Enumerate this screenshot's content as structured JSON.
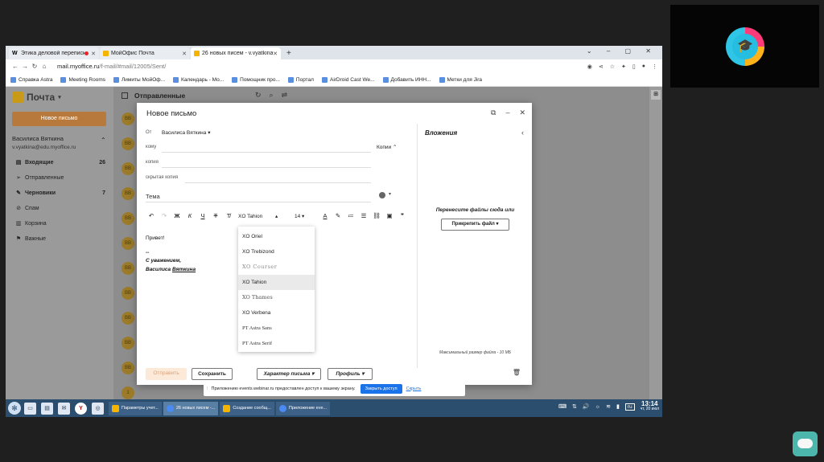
{
  "browser": {
    "tabs": [
      {
        "label": "Этика деловой переписки",
        "favicon": "W",
        "recording": true,
        "active": false
      },
      {
        "label": "МойОфис Почта",
        "favicon": "",
        "recording": false,
        "active": false
      },
      {
        "label": "26 новых писем - v.vyatkina",
        "favicon": "",
        "recording": false,
        "active": true
      }
    ],
    "url_host": "mail.myoffice.ru",
    "url_path": "/f-mail/#mail/12005/Sent/",
    "bookmarks": [
      "Справка Astra",
      "Meeting Rooms",
      "Лимиты МойОф...",
      "Календарь - Мо...",
      "Помощник про...",
      "Портал",
      "AirDroid Cast We...",
      "Добавить ИНН...",
      "Метки для Jira"
    ]
  },
  "mail": {
    "app_title": "Почта",
    "new_mail": "Новое письмо",
    "account_name": "Василиса Вяткина",
    "account_email": "v.vyatkina@edu.myoffice.ru",
    "folders": [
      {
        "label": "Входящие",
        "count": "26",
        "icon": "inbox-icon",
        "bold": true
      },
      {
        "label": "Отправленные",
        "count": "",
        "icon": "send-icon",
        "bold": false
      },
      {
        "label": "Черновики",
        "count": "7",
        "icon": "draft-icon",
        "bold": true
      },
      {
        "label": "Спам",
        "count": "",
        "icon": "spam-icon",
        "bold": false
      },
      {
        "label": "Корзина",
        "count": "",
        "icon": "trash-icon",
        "bold": false
      },
      {
        "label": "Важные",
        "count": "",
        "icon": "flag-icon",
        "bold": false
      }
    ],
    "list_title": "Отправленные",
    "avatar_initials": "ВВ",
    "footer_count": "1"
  },
  "compose": {
    "title": "Новое письмо",
    "from_label": "От",
    "from_value": "Василиса Вяткина",
    "to_label": "кому",
    "copies_label": "Копии",
    "cc_label": "копия",
    "bcc_label": "скрытая копия",
    "subject_placeholder": "Тема",
    "font_name": "XO Tahion",
    "font_size": "14",
    "greeting": "Привет!",
    "sig_dash": "--",
    "sig_regards": "С уважением,",
    "sig_first": "Василиса",
    "sig_last": "Вяткина",
    "font_options": [
      "XO Oriel",
      "XO Trebizond",
      "XO Courser",
      "XO Tahion",
      "XO Thames",
      "XO Verbena",
      "PT Astra Sans",
      "PT Astra Serif"
    ],
    "send_label": "Отправить",
    "save_label": "Сохранить",
    "character_label": "Характер письма",
    "profile_label": "Профиль",
    "attachments_title": "Вложения",
    "drop_text": "Перенесите файлы сюда или",
    "attach_label": "Прикрепить файл",
    "max_size": "Максимальный размер файла - 10 МБ"
  },
  "share_bar": {
    "message": "Приложению events.webinar.ru предоставлен доступ к вашему экрану.",
    "close_access": "Закрыть доступ",
    "hide": "Скрыть"
  },
  "taskbar": {
    "tasks": [
      {
        "label": "Параметры учет...",
        "active": false
      },
      {
        "label": "26 новых писем -...",
        "active": true
      },
      {
        "label": "Создание сообщ...",
        "active": false
      },
      {
        "label": "Приложение eve...",
        "active": false
      }
    ],
    "lang": "ru",
    "time": "13:14",
    "date": "чт, 20 июл"
  }
}
